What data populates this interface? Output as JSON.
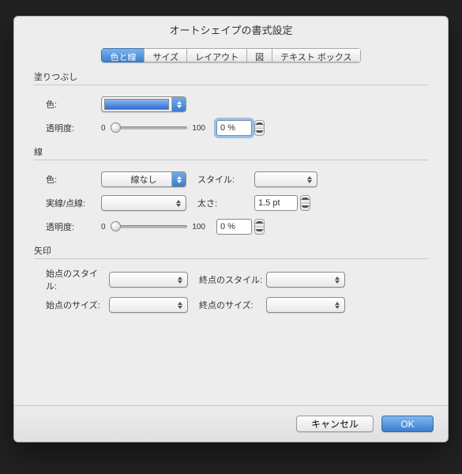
{
  "window": {
    "title": "オートシェイプの書式設定"
  },
  "tabs": {
    "color_line": "色と線",
    "size": "サイズ",
    "layout": "レイアウト",
    "picture": "図",
    "textbox": "テキスト ボックス"
  },
  "fill": {
    "section": "塗りつぶし",
    "color_label": "色:",
    "transparency_label": "透明度:",
    "transparency_min": "0",
    "transparency_max": "100",
    "transparency_value": "0 %"
  },
  "line": {
    "section": "線",
    "color_label": "色:",
    "color_value": "線なし",
    "style_label": "スタイル:",
    "dash_label": "実線/点線:",
    "weight_label": "太さ:",
    "weight_value": "1.5 pt",
    "transparency_label": "透明度:",
    "transparency_min": "0",
    "transparency_max": "100",
    "transparency_value": "0 %"
  },
  "arrows": {
    "section": "矢印",
    "begin_style": "始点のスタイル:",
    "end_style": "終点のスタイル:",
    "begin_size": "始点のサイズ:",
    "end_size": "終点のサイズ:"
  },
  "buttons": {
    "cancel": "キャンセル",
    "ok": "OK"
  }
}
